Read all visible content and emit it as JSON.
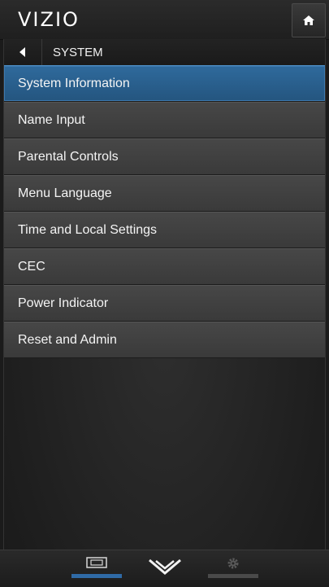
{
  "header": {
    "logo_text": "VIZIO",
    "home_icon": "home-icon"
  },
  "breadcrumb": {
    "back_icon": "back-arrow-icon",
    "title": "SYSTEM"
  },
  "menu": {
    "items": [
      {
        "label": "System Information",
        "selected": true
      },
      {
        "label": "Name Input",
        "selected": false
      },
      {
        "label": "Parental Controls",
        "selected": false
      },
      {
        "label": "Menu Language",
        "selected": false
      },
      {
        "label": "Time and Local Settings",
        "selected": false
      },
      {
        "label": "CEC",
        "selected": false
      },
      {
        "label": "Power Indicator",
        "selected": false
      },
      {
        "label": "Reset and Admin",
        "selected": false
      }
    ]
  },
  "bottom_nav": {
    "tabs": [
      {
        "icon": "input-screen-icon",
        "active": true
      },
      {
        "icon": "vizio-chevron-icon",
        "active": false
      },
      {
        "icon": "gear-icon",
        "active": false
      }
    ]
  },
  "colors": {
    "accent": "#2f6aa6",
    "selected_row": "#2a5f8e",
    "row": "#404040",
    "background": "#1e1e1e"
  }
}
